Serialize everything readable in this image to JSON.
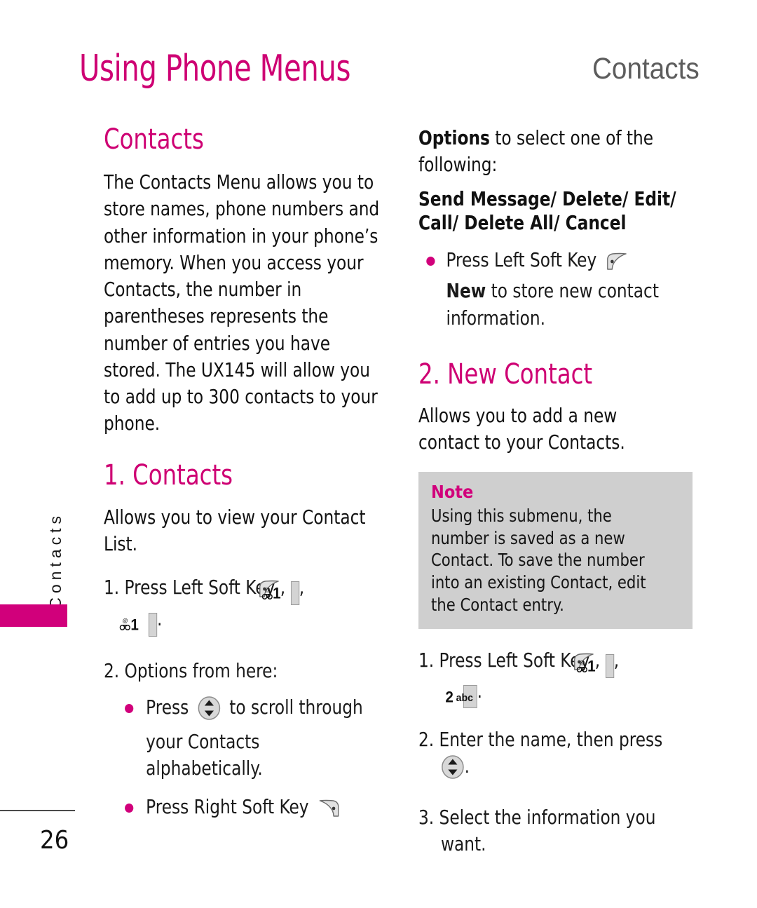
{
  "header": {
    "title": "Using Phone Menus",
    "section": "Contacts",
    "title_color": "#CE0073",
    "section_color": "#5D5D5D"
  },
  "side_tab": {
    "label": "Contacts",
    "bar_color": "#D1007B"
  },
  "left_column": {
    "heading": "Contacts",
    "intro": "The Contacts Menu allows you to store names, phone numbers and other information in your phone’s memory. When you access your Contacts, the number in parentheses represents the number of entries you have stored. The UX145 will allow you to add up to 300 contacts to your phone.",
    "subheading": "1. Contacts",
    "sub_intro": "Allows you to view your Contact List.",
    "step1_prefix": "1. Press Left Soft Key",
    "step1_sep1": ",",
    "step1_sep2": ",",
    "step1_end": ".",
    "step2": "2. Options from here:",
    "bullet1_pre": "Press",
    "bullet1_post": "to scroll through your Contacts alphabetically.",
    "bullet2": "Press Right Soft Key"
  },
  "right_column": {
    "options_lead_bold": "Options",
    "options_lead_rest": " to select one of the following:",
    "options_list": "Send Message/ Delete/ Edit/ Call/ Delete All/ Cancel",
    "bullet1_pre": "Press Left Soft Key",
    "bullet1_bold": "New",
    "bullet1_post": " to store new contact information.",
    "heading2": "2. New Contact",
    "intro2": "Allows you to add a new contact to your Contacts.",
    "note": {
      "title": "Note",
      "body": "Using this submenu, the number is saved as a new Contact. To save the number into an existing Contact, edit the Contact entry."
    },
    "step1_prefix": "1. Press Left Soft Key",
    "step1_sep1": ",",
    "step1_sep2": ",",
    "step1_end": ".",
    "step2_text": "2. Enter the name, then press",
    "step2_end": ".",
    "step3": "3. Select the information you want."
  },
  "keys": {
    "key1_digit": "1",
    "key2_digit": "2",
    "key2_letters": "abc"
  },
  "footer": {
    "page_number": "26"
  }
}
